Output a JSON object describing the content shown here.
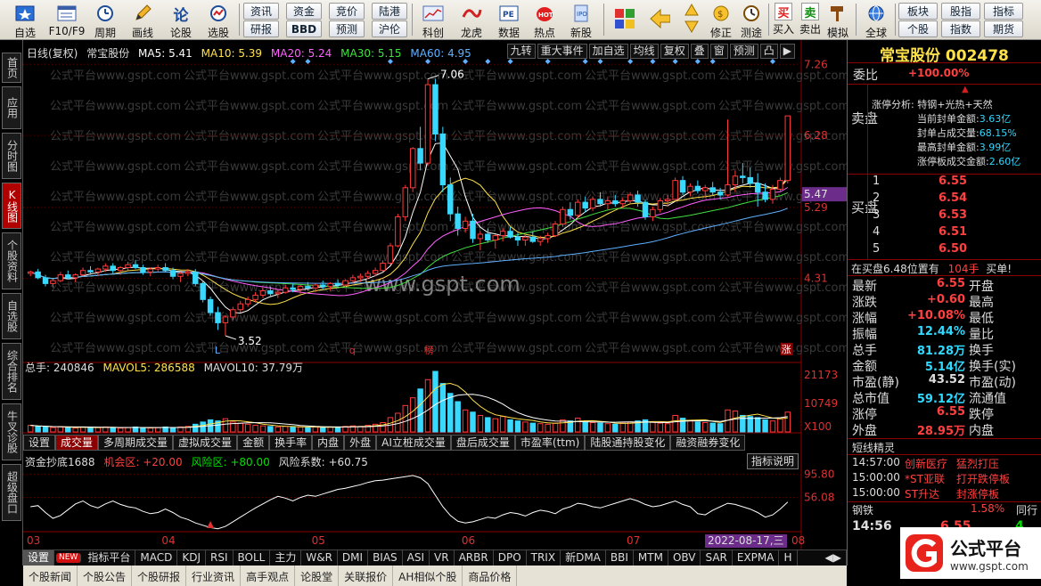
{
  "toolbar": {
    "items": [
      {
        "name": "self-select-button",
        "label": "自选",
        "icon": "star-icon"
      },
      {
        "name": "f10-button",
        "label": "F10/F9",
        "icon": "f10-icon"
      },
      {
        "name": "period-button",
        "label": "周期",
        "icon": "clock-icon"
      },
      {
        "name": "draw-line-button",
        "label": "画线",
        "icon": "pencil-icon"
      },
      {
        "name": "commentary-button",
        "label": "论股",
        "icon": "discuss-icon"
      },
      {
        "name": "stock-picker-button",
        "label": "选股",
        "icon": "gauge-icon"
      }
    ],
    "buttons_row1": [
      "资讯",
      "资金",
      "竞价",
      "陆港"
    ],
    "buttons_row2": [
      "研报",
      "BBD",
      "预测",
      "沪伦"
    ],
    "items2": [
      {
        "name": "tech-button",
        "label": "科创",
        "icon": "chart-icon"
      },
      {
        "name": "dragon-tiger-button",
        "label": "龙虎",
        "icon": "dragon-icon"
      },
      {
        "name": "data-button",
        "label": "数据",
        "icon": "pe-icon"
      },
      {
        "name": "hot-button",
        "label": "热点",
        "icon": "hot-icon"
      },
      {
        "name": "new-stock-button",
        "label": "新股",
        "icon": "ipo-icon"
      }
    ],
    "items3": [
      {
        "name": "revise-button",
        "label": "修正",
        "icon": "revise-icon"
      },
      {
        "name": "backtest-button",
        "label": "测途",
        "icon": "clock-icon"
      },
      {
        "name": "buy-button",
        "label": "买入",
        "icon": "buy-icon",
        "glyph": "买"
      },
      {
        "name": "sell-button",
        "label": "卖出",
        "icon": "sell-icon",
        "glyph": "卖"
      },
      {
        "name": "simulate-button",
        "label": "模拟",
        "icon": "hammer-icon"
      },
      {
        "name": "global-button",
        "label": "全球",
        "icon": "globe-icon"
      }
    ],
    "right_row1": [
      "板块",
      "股指",
      "指标"
    ],
    "right_row2": [
      "个股",
      "指数",
      "期货"
    ]
  },
  "sidebar": {
    "tabs": [
      {
        "label": "首页"
      },
      {
        "label": "应用"
      },
      {
        "label": "分时图"
      },
      {
        "label": "K线图",
        "active": true
      },
      {
        "label": "个股资料"
      },
      {
        "label": "自选股"
      },
      {
        "label": "综合排名"
      },
      {
        "label": "牛叉诊股"
      },
      {
        "label": "超级盘口"
      }
    ]
  },
  "chart": {
    "header": {
      "period": "日线(复权)",
      "stock": "常宝股份",
      "ma5": "MA5: 5.41",
      "ma10": "MA10: 5.39",
      "ma20": "MA20: 5.24",
      "ma30": "MA30: 5.15",
      "ma60": "MA60: 4.95"
    },
    "top_buttons": [
      "九转",
      "重大事件",
      "加自选",
      "均线",
      "复权",
      "叠",
      "窗",
      "预测",
      "凸",
      "▶"
    ],
    "watermark": "www.gspt.com",
    "watermark_small": "公式平台www.gspt.com",
    "price_axis": [
      "7.26",
      "6.28",
      "5.29",
      "4.31"
    ],
    "current_price_tag": "5.47",
    "annotations": {
      "high": "7.06",
      "low": "3.52",
      "marker_l": "L",
      "marker_q": "q",
      "marker_bang": "榜",
      "marker_zhang": "涨"
    },
    "volume_header": {
      "label": "总手: 240846",
      "mavol5": "MAVOL5: 286588",
      "mavol10": "MAVOL10: 37.79万"
    },
    "volume_axis": [
      "21173",
      "10749",
      "X100"
    ],
    "indicator_tabs": [
      "设置",
      "成交量",
      "多周期成交量",
      "虚拟成交量",
      "金额",
      "换手率",
      "内盘",
      "外盘",
      "AI立桩成交量",
      "盘后成交量",
      "市盈率(ttm)",
      "陆股通持股变化",
      "融资融券变化"
    ],
    "indicator_header": {
      "name": "资金抄底1688",
      "opportunity": "机会区: +20.00",
      "risk": "风险区: +80.00",
      "risk_coef": "风险系数: +60.75"
    },
    "indicator_button": "指标说明",
    "indicator_axis": [
      "95.80",
      "56.08"
    ],
    "date_labels": [
      "03",
      "04",
      "05",
      "06",
      "07",
      "08"
    ],
    "date_cursor": "2022-08-17,三"
  },
  "chart_data": {
    "type": "candlestick",
    "title": "常宝股份 日线(复权)",
    "ylim": [
      3.3,
      7.3
    ],
    "volume_ylim": [
      0,
      26000
    ],
    "indicator_ylim": [
      0,
      100
    ],
    "candles": [
      [
        4.38,
        4.42,
        4.34,
        4.4
      ],
      [
        4.4,
        4.44,
        4.3,
        4.32
      ],
      [
        4.32,
        4.36,
        4.2,
        4.24
      ],
      [
        4.24,
        4.3,
        4.18,
        4.28
      ],
      [
        4.28,
        4.4,
        4.26,
        4.36
      ],
      [
        4.36,
        4.42,
        4.3,
        4.32
      ],
      [
        4.32,
        4.38,
        4.26,
        4.36
      ],
      [
        4.36,
        4.46,
        4.34,
        4.42
      ],
      [
        4.42,
        4.48,
        4.36,
        4.4
      ],
      [
        4.4,
        4.46,
        4.34,
        4.44
      ],
      [
        4.44,
        4.52,
        4.4,
        4.48
      ],
      [
        4.48,
        4.52,
        4.38,
        4.42
      ],
      [
        4.42,
        4.48,
        4.36,
        4.46
      ],
      [
        4.46,
        4.54,
        4.42,
        4.5
      ],
      [
        4.5,
        4.56,
        4.44,
        4.46
      ],
      [
        4.46,
        4.5,
        4.36,
        4.4
      ],
      [
        4.4,
        4.46,
        4.34,
        4.44
      ],
      [
        4.44,
        4.5,
        4.4,
        4.46
      ],
      [
        4.46,
        4.52,
        4.4,
        4.42
      ],
      [
        4.42,
        4.46,
        4.3,
        4.34
      ],
      [
        4.34,
        4.4,
        4.26,
        4.38
      ],
      [
        4.38,
        4.44,
        4.34,
        4.4
      ],
      [
        4.4,
        4.44,
        4.2,
        4.24
      ],
      [
        4.24,
        4.28,
        3.98,
        4.02
      ],
      [
        4.02,
        4.06,
        3.8,
        3.84
      ],
      [
        3.84,
        3.92,
        3.6,
        3.7
      ],
      [
        3.7,
        3.8,
        3.52,
        3.78
      ],
      [
        3.78,
        3.92,
        3.74,
        3.88
      ],
      [
        3.88,
        4.0,
        3.84,
        3.96
      ],
      [
        3.96,
        4.06,
        3.92,
        4.02
      ],
      [
        4.02,
        4.12,
        3.98,
        4.08
      ],
      [
        4.08,
        4.18,
        4.04,
        4.14
      ],
      [
        4.14,
        4.2,
        4.06,
        4.1
      ],
      [
        4.1,
        4.16,
        4.04,
        4.12
      ],
      [
        4.12,
        4.22,
        4.1,
        4.18
      ],
      [
        4.18,
        4.24,
        4.12,
        4.16
      ],
      [
        4.16,
        4.22,
        4.1,
        4.2
      ],
      [
        4.2,
        4.26,
        4.14,
        4.18
      ],
      [
        4.18,
        4.24,
        4.12,
        4.22
      ],
      [
        4.22,
        4.28,
        4.16,
        4.2
      ],
      [
        4.2,
        4.26,
        4.14,
        4.24
      ],
      [
        4.24,
        4.3,
        4.18,
        4.22
      ],
      [
        4.22,
        4.3,
        4.18,
        4.28
      ],
      [
        4.28,
        4.36,
        4.24,
        4.32
      ],
      [
        4.32,
        4.38,
        4.26,
        4.34
      ],
      [
        4.34,
        4.42,
        4.3,
        4.38
      ],
      [
        4.38,
        4.46,
        4.34,
        4.42
      ],
      [
        4.42,
        4.56,
        4.4,
        4.52
      ],
      [
        4.52,
        4.8,
        4.5,
        4.76
      ],
      [
        4.76,
        5.2,
        4.74,
        5.16
      ],
      [
        5.16,
        5.6,
        5.1,
        5.56
      ],
      [
        5.56,
        6.12,
        5.5,
        6.1
      ],
      [
        6.1,
        6.4,
        5.8,
        5.9
      ],
      [
        5.9,
        7.06,
        5.86,
        6.98
      ],
      [
        6.98,
        7.06,
        6.2,
        6.3
      ],
      [
        6.3,
        6.4,
        5.5,
        5.6
      ],
      [
        5.6,
        5.7,
        5.1,
        5.2
      ],
      [
        5.2,
        5.3,
        4.9,
        5.0
      ],
      [
        5.0,
        5.16,
        4.94,
        5.1
      ],
      [
        5.1,
        5.2,
        4.8,
        4.86
      ],
      [
        4.86,
        4.96,
        4.7,
        4.92
      ],
      [
        4.92,
        5.0,
        4.8,
        4.84
      ],
      [
        4.84,
        4.92,
        4.72,
        4.9
      ],
      [
        4.9,
        5.0,
        4.82,
        4.96
      ],
      [
        4.96,
        5.02,
        4.86,
        4.88
      ],
      [
        4.88,
        4.94,
        4.76,
        4.84
      ],
      [
        4.84,
        4.92,
        4.76,
        4.88
      ],
      [
        4.88,
        4.96,
        4.8,
        4.82
      ],
      [
        4.82,
        4.9,
        4.76,
        4.86
      ],
      [
        4.86,
        4.94,
        4.8,
        4.9
      ],
      [
        4.9,
        5.1,
        4.88,
        5.06
      ],
      [
        5.06,
        5.3,
        5.02,
        5.26
      ],
      [
        5.26,
        5.36,
        5.12,
        5.18
      ],
      [
        5.18,
        5.4,
        5.14,
        5.36
      ],
      [
        5.36,
        5.44,
        5.22,
        5.28
      ],
      [
        5.28,
        5.44,
        5.24,
        5.4
      ],
      [
        5.4,
        5.5,
        5.3,
        5.34
      ],
      [
        5.34,
        5.44,
        5.26,
        5.38
      ],
      [
        5.38,
        5.46,
        5.3,
        5.34
      ],
      [
        5.34,
        5.42,
        5.28,
        5.38
      ],
      [
        5.38,
        5.5,
        5.34,
        5.46
      ],
      [
        5.46,
        5.52,
        5.3,
        5.36
      ],
      [
        5.36,
        5.4,
        5.12,
        5.16
      ],
      [
        5.16,
        5.3,
        5.1,
        5.26
      ],
      [
        5.26,
        5.42,
        5.22,
        5.38
      ],
      [
        5.38,
        5.46,
        5.3,
        5.4
      ],
      [
        5.4,
        5.7,
        5.38,
        5.66
      ],
      [
        5.66,
        5.72,
        5.46,
        5.5
      ],
      [
        5.5,
        5.62,
        5.44,
        5.58
      ],
      [
        5.58,
        5.66,
        5.48,
        5.52
      ],
      [
        5.52,
        5.6,
        5.42,
        5.56
      ],
      [
        5.56,
        5.64,
        5.46,
        5.5
      ],
      [
        5.5,
        5.56,
        5.4,
        5.46
      ],
      [
        5.46,
        6.5,
        5.44,
        5.6
      ],
      [
        5.6,
        5.8,
        5.5,
        5.72
      ],
      [
        5.72,
        5.9,
        5.62,
        5.7
      ],
      [
        5.7,
        5.84,
        5.56,
        5.62
      ],
      [
        5.62,
        5.76,
        5.3,
        5.5
      ],
      [
        5.5,
        5.62,
        5.36,
        5.4
      ],
      [
        5.4,
        5.6,
        5.34,
        5.54
      ],
      [
        5.54,
        5.7,
        5.5,
        5.66
      ],
      [
        5.66,
        6.55,
        5.62,
        6.55
      ]
    ],
    "volumes": [
      12,
      10,
      9,
      8,
      9,
      8,
      7,
      9,
      8,
      8,
      9,
      8,
      7,
      8,
      9,
      8,
      7,
      8,
      9,
      8,
      9,
      10,
      14,
      18,
      22,
      20,
      24,
      18,
      16,
      14,
      12,
      11,
      10,
      9,
      10,
      9,
      9,
      8,
      9,
      8,
      9,
      9,
      10,
      11,
      10,
      12,
      14,
      17,
      26,
      34,
      48,
      62,
      78,
      95,
      110,
      88,
      70,
      55,
      40,
      36,
      30,
      26,
      24,
      28,
      22,
      20,
      18,
      16,
      15,
      14,
      16,
      22,
      20,
      25,
      18,
      17,
      16,
      15,
      14,
      16,
      18,
      20,
      22,
      18,
      16,
      15,
      30,
      25,
      20,
      18,
      17,
      16,
      15,
      40,
      38,
      30,
      28,
      26,
      22,
      20,
      24,
      36
    ],
    "indicator": [
      40,
      42,
      30,
      20,
      25,
      35,
      45,
      50,
      42,
      38,
      45,
      50,
      44,
      40,
      38,
      32,
      28,
      30,
      36,
      30,
      22,
      18,
      12,
      8,
      4,
      2,
      6,
      14,
      22,
      30,
      38,
      45,
      52,
      58,
      55,
      50,
      56,
      60,
      58,
      62,
      66,
      70,
      72,
      75,
      78,
      82,
      85,
      86,
      88,
      90,
      92,
      94,
      90,
      80,
      60,
      40,
      25,
      15,
      12,
      14,
      18,
      22,
      20,
      26,
      30,
      28,
      24,
      30,
      34,
      32,
      28,
      36,
      40,
      46,
      44,
      40,
      38,
      42,
      46,
      50,
      54,
      50,
      44,
      40,
      42,
      46,
      50,
      44,
      40,
      28,
      26,
      34,
      40,
      46,
      44,
      40,
      36,
      30,
      22,
      26,
      36,
      48,
      56
    ]
  },
  "right": {
    "title": "常宝股份 002478",
    "weibi_label": "委比",
    "weibi_value": "+100.00%",
    "sell_label": "卖盘",
    "limit_analysis": "涨停分析: 特钢+光热+天然",
    "limit_lines": [
      {
        "k": "当前封单金额:",
        "v": "3.63亿"
      },
      {
        "k": "封单占成交量:",
        "v": "68.15%"
      },
      {
        "k": "最高封单金额:",
        "v": "3.99亿"
      },
      {
        "k": "涨停板成交金额:",
        "v": "2.60亿"
      }
    ],
    "buy_label": "买盘",
    "bids": [
      {
        "lvl": "1",
        "price": "6.55"
      },
      {
        "lvl": "2",
        "price": "6.54"
      },
      {
        "lvl": "3",
        "price": "6.53"
      },
      {
        "lvl": "4",
        "price": "6.51"
      },
      {
        "lvl": "5",
        "price": "6.50"
      }
    ],
    "bid_note": "在买盘6.48位置有",
    "bid_note_qty": "104手",
    "bid_note_act": "买单!",
    "quotes": [
      {
        "k1": "最新",
        "v1": "6.55",
        "k2": "开盘",
        "v2": ""
      },
      {
        "k1": "涨跌",
        "v1": "+0.60",
        "k2": "最高",
        "v2": ""
      },
      {
        "k1": "涨幅",
        "v1": "+10.08%",
        "k2": "最低",
        "v2": ""
      },
      {
        "k1": "振幅",
        "v1": "12.44%",
        "k2": "量比",
        "v2": ""
      },
      {
        "k1": "总手",
        "v1": "81.28万",
        "k2": "换手",
        "v2": ""
      },
      {
        "k1": "金额",
        "v1": "5.14亿",
        "k2": "换手(实)",
        "v2": ""
      },
      {
        "k1": "市盈(静)",
        "v1": "43.52",
        "k2": "市盈(动)",
        "v2": ""
      },
      {
        "k1": "总市值",
        "v1": "59.12亿",
        "k2": "流通值",
        "v2": ""
      },
      {
        "k1": "涨停",
        "v1": "6.55",
        "k2": "跌停",
        "v2": ""
      },
      {
        "k1": "外盘",
        "v1": "28.95万",
        "k2": "内盘",
        "v2": ""
      }
    ],
    "sprite_title": "短线精灵",
    "sprites": [
      {
        "time": "14:57:00",
        "name": "创新医疗",
        "event": "猛烈打压"
      },
      {
        "time": "15:00:00",
        "name": "*ST亚联",
        "event": "打开跌停板"
      },
      {
        "time": "15:00:00",
        "name": "ST升达",
        "event": "封涨停板"
      }
    ],
    "ticker_name": "钢铁",
    "ticker_value": "1.58%",
    "ticker_extra": "同行",
    "last_time": "14:56",
    "last_price": "6.55",
    "last_qty": "4",
    "brand": "公式平台",
    "brand_url": "www.gspt.com"
  },
  "bottom_tabs": [
    "设置",
    "NEW",
    "指标平台",
    "MACD",
    "KDJ",
    "RSI",
    "BOLL",
    "主力",
    "W&R",
    "DMI",
    "BIAS",
    "ASI",
    "VR",
    "ARBR",
    "DPO",
    "TRIX",
    "新DMA",
    "BBI",
    "MTM",
    "OBV",
    "SAR",
    "EXPMA",
    "H"
  ],
  "news_tabs": [
    "个股新闻",
    "个股公告",
    "个股研报",
    "行业资讯",
    "高手观点",
    "论股堂",
    "关联报价",
    "AH相似个股",
    "商品价格"
  ]
}
